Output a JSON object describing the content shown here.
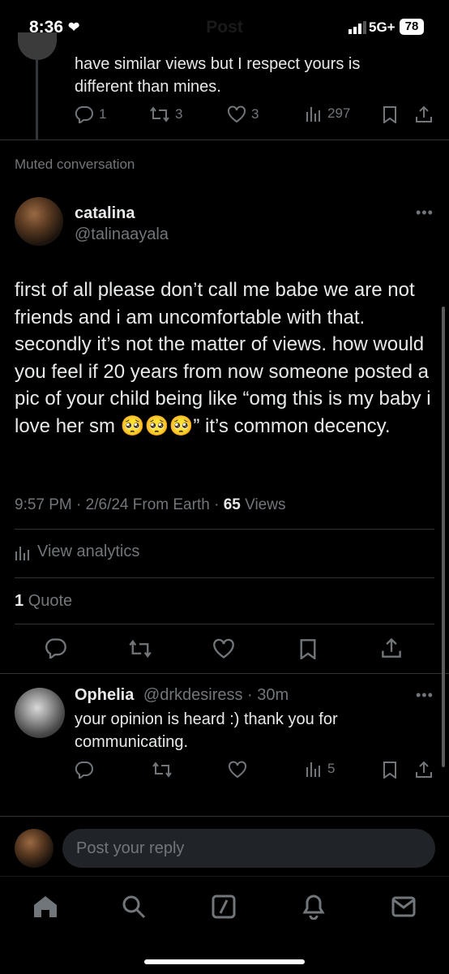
{
  "status_bar": {
    "time": "8:36",
    "network": "5G+",
    "battery": "78"
  },
  "header": {
    "title": "Post"
  },
  "prev_post": {
    "text": "have similar views but I respect yours is different than mines.",
    "replies": "1",
    "reposts": "3",
    "likes": "3",
    "views": "297"
  },
  "muted_label": "Muted conversation",
  "main_post": {
    "name": "catalina",
    "handle": "@talinaayala",
    "text": "first of all please don’t call me babe we are not friends and i am uncomfortable with that. secondly it’s not the matter of views. how would you feel if 20 years from now someone posted a pic of your child being like “omg this is my baby i love her sm 🥺🥺🥺” it’s common decency.",
    "time": "9:57 PM",
    "date": "2/6/24",
    "source": "From Earth",
    "views_count": "65",
    "views_label": "Views",
    "analytics_label": "View analytics",
    "quote_count": "1",
    "quote_label": "Quote"
  },
  "reply": {
    "name": "Ophelia",
    "handle": "@drkdesiress",
    "time": "30m",
    "text": "your opinion is heard :) thank you for communicating.",
    "views": "5"
  },
  "composer": {
    "placeholder": "Post your reply"
  },
  "nav": [
    "home-icon",
    "search-icon",
    "grok-icon",
    "notifications-icon",
    "messages-icon"
  ]
}
